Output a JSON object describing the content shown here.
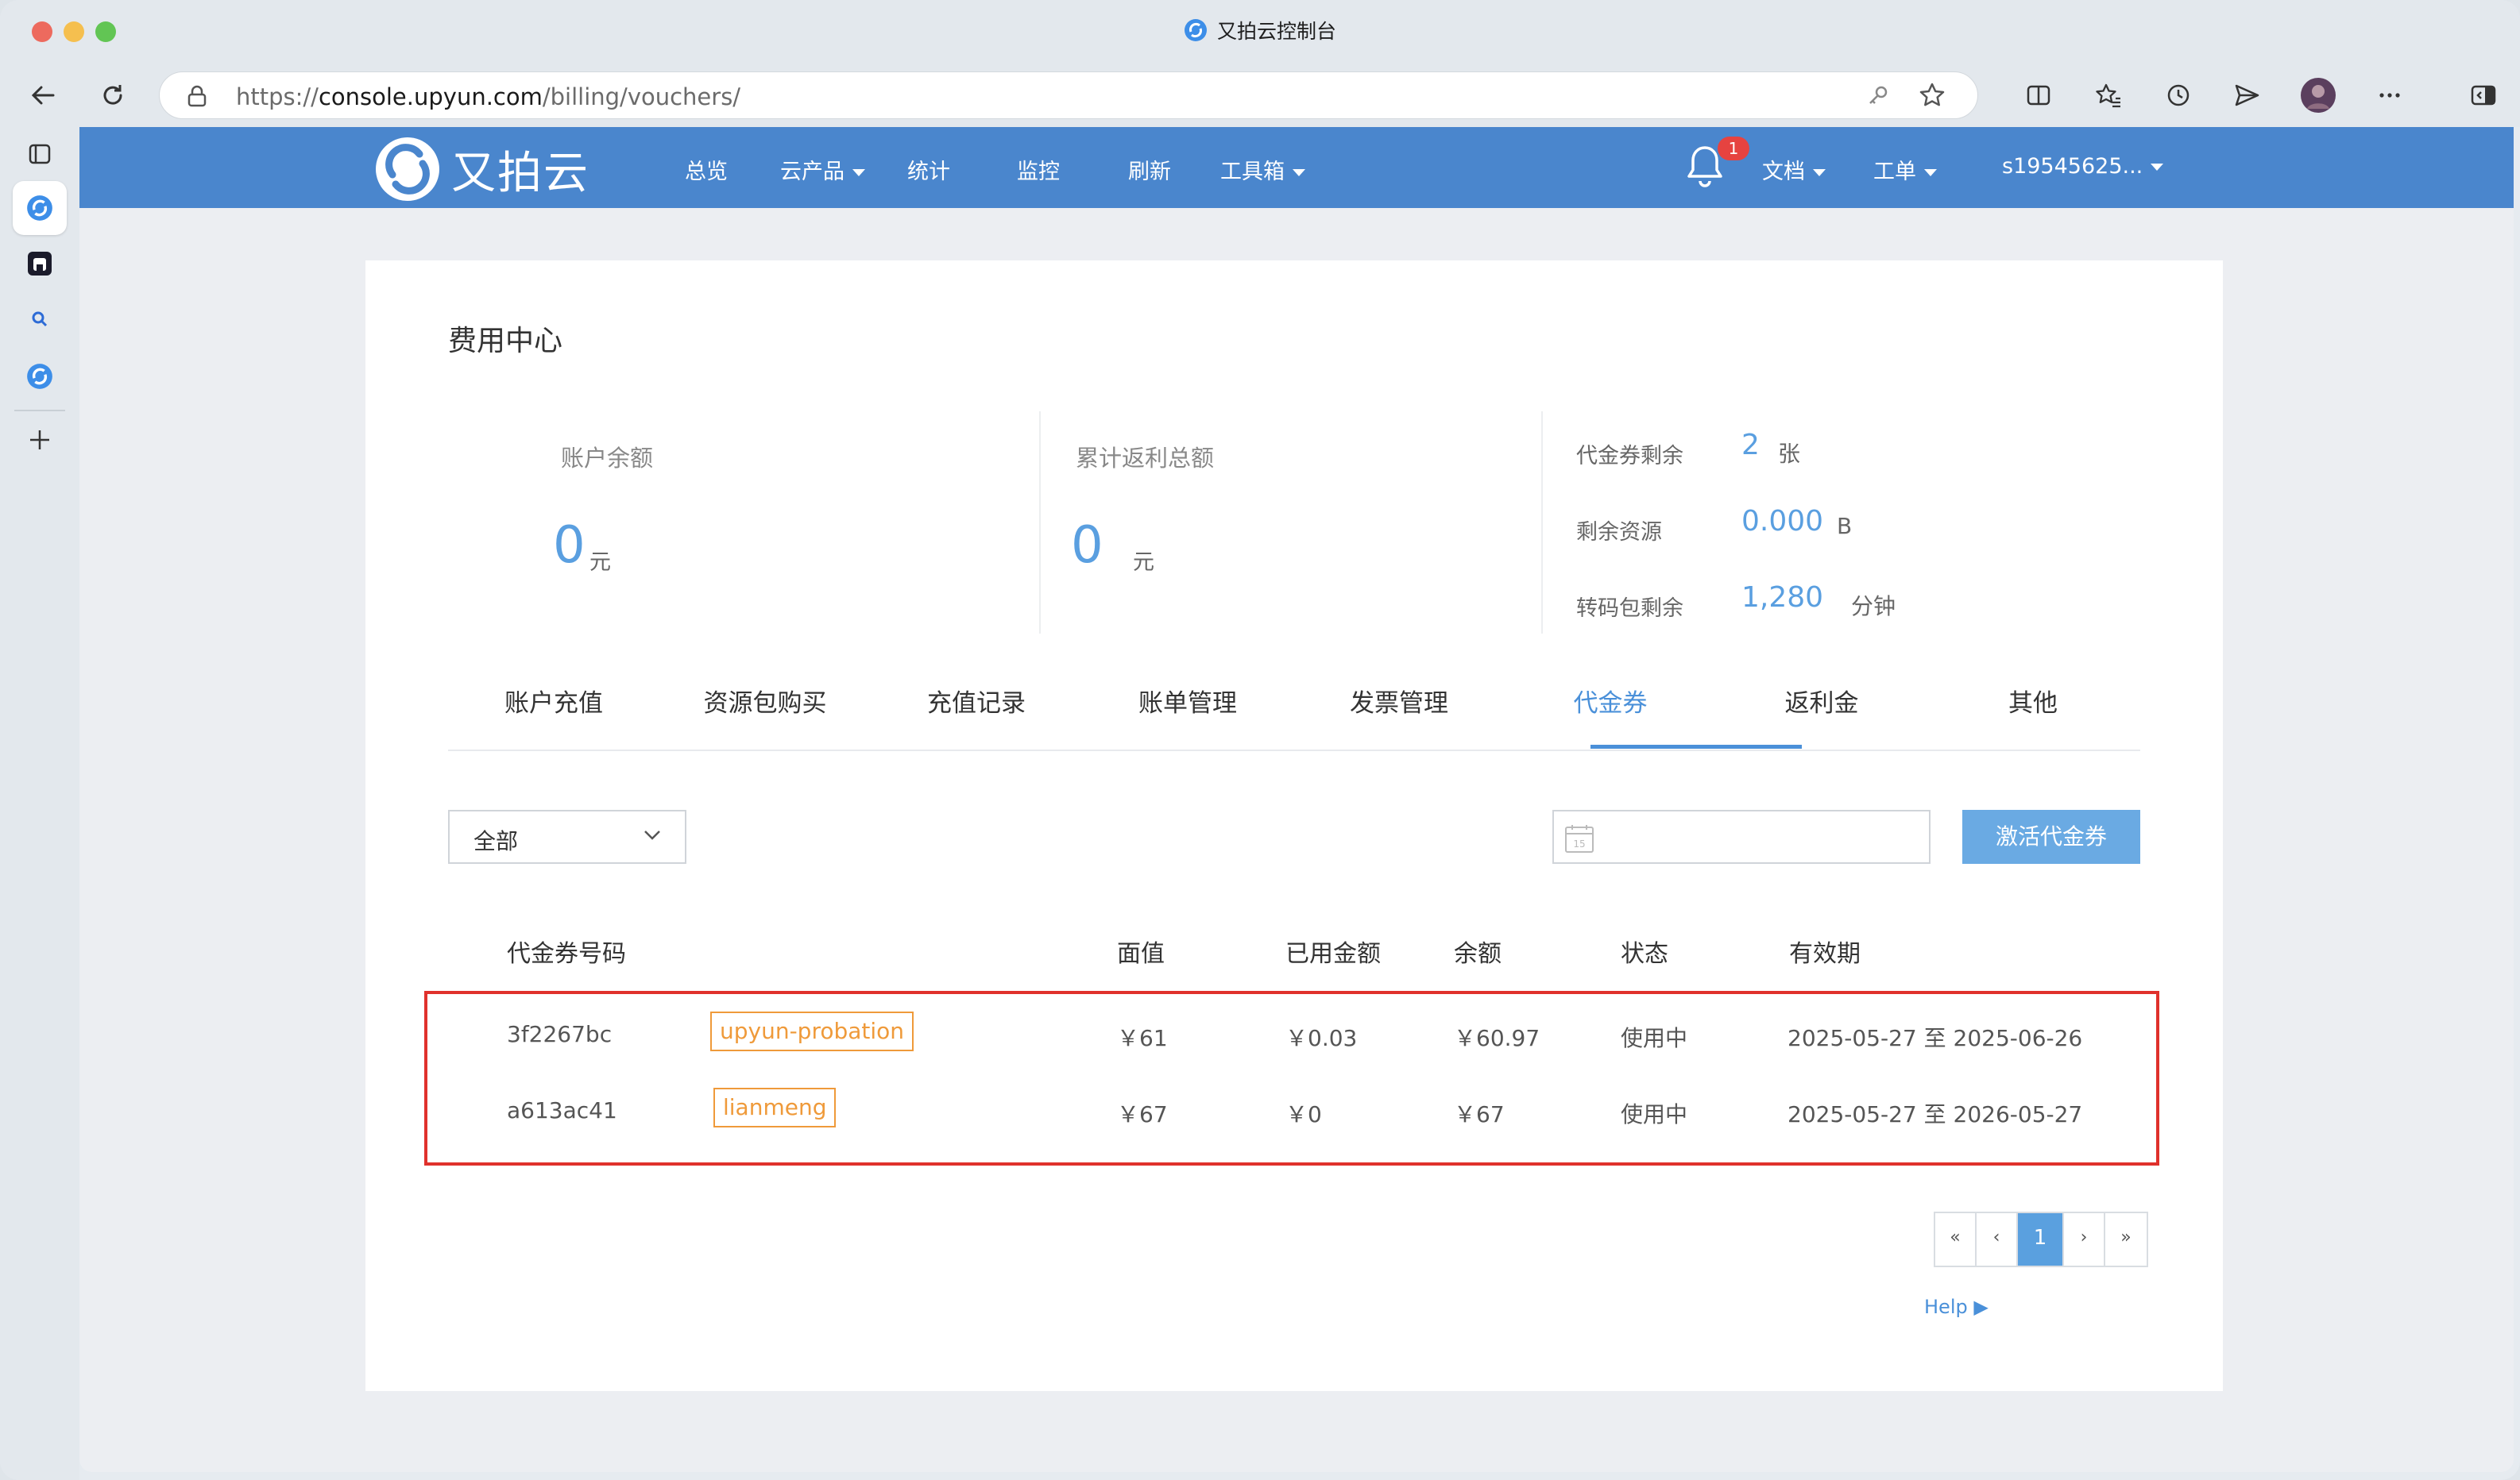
{
  "browser": {
    "tab_title": "又拍云控制台",
    "url_scheme": "https://",
    "url_host": "console.upyun.com",
    "url_path": "/billing/vouchers/"
  },
  "nav": {
    "logo_text": "又拍云",
    "items": [
      "总览",
      "云产品",
      "统计",
      "监控",
      "刷新",
      "工具箱"
    ],
    "notification_count": "1",
    "docs": "文档",
    "tickets": "工单",
    "user": "s19545625..."
  },
  "billing": {
    "title": "费用中心",
    "balance": {
      "label": "账户余额",
      "value": "0",
      "unit": "元"
    },
    "rebate": {
      "label": "累计返利总额",
      "value": "0",
      "unit": "元"
    },
    "vouchers_left": {
      "label": "代金券剩余",
      "value": "2",
      "unit": "张"
    },
    "resources_left": {
      "label": "剩余资源",
      "value": "0.000",
      "unit": "B"
    },
    "transcode_left": {
      "label": "转码包剩余",
      "value": "1,280",
      "unit": "分钟"
    }
  },
  "tabs": [
    "账户充值",
    "资源包购买",
    "充值记录",
    "账单管理",
    "发票管理",
    "代金券",
    "返利金",
    "其他"
  ],
  "active_tab": "代金券",
  "filter": {
    "select_value": "全部",
    "activate_button": "激活代金券"
  },
  "table": {
    "headers": [
      "代金券号码",
      "面值",
      "已用金额",
      "余额",
      "状态",
      "有效期"
    ],
    "rows": [
      {
        "code": "3f2267bc",
        "tag": "upyun-probation",
        "face": "￥61",
        "used": "￥0.03",
        "balance": "￥60.97",
        "status": "使用中",
        "validity": "2025-05-27 至 2025-06-26"
      },
      {
        "code": "a613ac41",
        "tag": "lianmeng",
        "face": "￥67",
        "used": "￥0",
        "balance": "￥67",
        "status": "使用中",
        "validity": "2025-05-27 至 2026-05-27"
      }
    ]
  },
  "pagination": {
    "first": "«",
    "prev": "‹",
    "current": "1",
    "next": "›",
    "last": "»"
  },
  "help_link": "Help ▶",
  "colors": {
    "nav": "#4a86cd",
    "accent": "#5a9fe0",
    "tag": "#ef9a3a",
    "highlight_box": "#e0312c"
  }
}
